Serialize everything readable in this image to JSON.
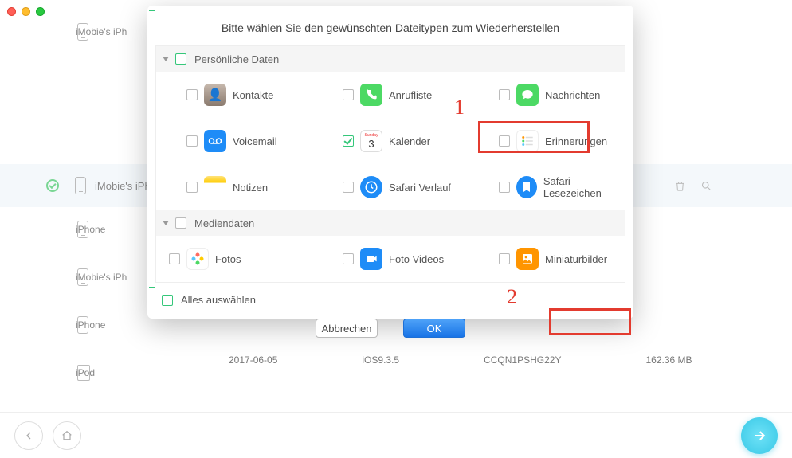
{
  "dialog": {
    "title": "Bitte wählen Sie den gewünschten Dateitypen zum Wiederherstellen",
    "groups": [
      {
        "label": "Persönliche Daten",
        "items": [
          "Kontakte",
          "Anrufliste",
          "Nachrichten",
          "Voicemail",
          "Kalender",
          "Erinnerungen",
          "Notizen",
          "Safari Verlauf",
          "Safari Lesezeichen"
        ]
      },
      {
        "label": "Mediendaten",
        "items": [
          "Fotos",
          "Foto Videos",
          "Miniaturbilder"
        ]
      }
    ],
    "select_all": "Alles auswählen",
    "cancel": "Abbrechen",
    "ok": "OK",
    "checked_item": "Kalender"
  },
  "annotations": {
    "one": "1",
    "two": "2"
  },
  "sidebar": {
    "items": [
      "iMobie's iPh",
      "iMobie's iPh",
      "iPhone",
      "iMobie's iPh",
      "iPhone",
      "iPod"
    ],
    "selected_index": 1
  },
  "details": {
    "date": "2017-06-05",
    "ios": "iOS9.3.5",
    "serial": "CCQN1PSHG22Y",
    "size": "162.36 MB"
  },
  "colors": {
    "accent_green": "#35c77a",
    "hl_red": "#e33b2f"
  }
}
